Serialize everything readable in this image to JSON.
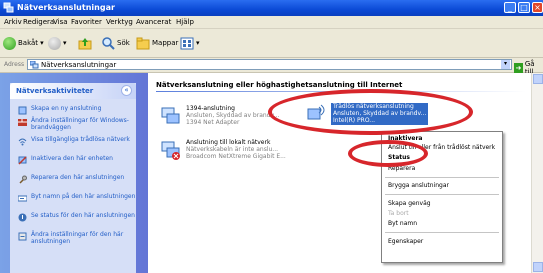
{
  "window": {
    "title": "Nätverksanslutningar"
  },
  "menu": [
    "Arkiv",
    "Redigera",
    "Visa",
    "Favoriter",
    "Verktyg",
    "Avancerat",
    "Hjälp"
  ],
  "toolbar": {
    "back": "Bakåt",
    "search": "Sök",
    "folders": "Mappar"
  },
  "address": {
    "label": "Adress",
    "value": "Nätverksanslutningar",
    "go": "Gå till"
  },
  "sidebar": {
    "title": "Nätverksaktiviteter",
    "tasks": [
      "Skapa en ny anslutning",
      "Ändra inställningar för Windows-brandväggen",
      "Visa tillgängliga trådlösa nätverk",
      "Inaktivera den här enheten",
      "Reparera den här anslutningen",
      "Byt namn på den här anslutningen",
      "Se status för den här anslutningen",
      "Ändra inställningar för den här anslutningen"
    ]
  },
  "main": {
    "heading": "Nätverksanslutning eller höghastighetsanslutning till Internet",
    "connections": [
      {
        "name": "1394-anslutning",
        "status": "Ansluten, Skyddad av brandv...",
        "device": "1394 Net Adapter"
      },
      {
        "name": "Trådlös nätverksanslutning",
        "status": "Ansluten, Skyddad av brandv...",
        "device": "Intel(R) PRO..."
      },
      {
        "name": "Anslutning till lokalt nätverk",
        "status": "Nätverkskabeln är inte anslu...",
        "device": "Broadcom NetXtreme Gigabit E..."
      }
    ]
  },
  "context_menu": {
    "items": [
      "Inaktivera",
      "Anslut till eller från trådlöst nätverk",
      "Status",
      "Reparera",
      "Brygga anslutningar",
      "Skapa genväg",
      "Ta bort",
      "Byt namn",
      "Egenskaper"
    ]
  },
  "colors": {
    "highlight_ring": "#d7262b",
    "selection": "#316ac5",
    "titlebar": "#0b4ad6"
  }
}
